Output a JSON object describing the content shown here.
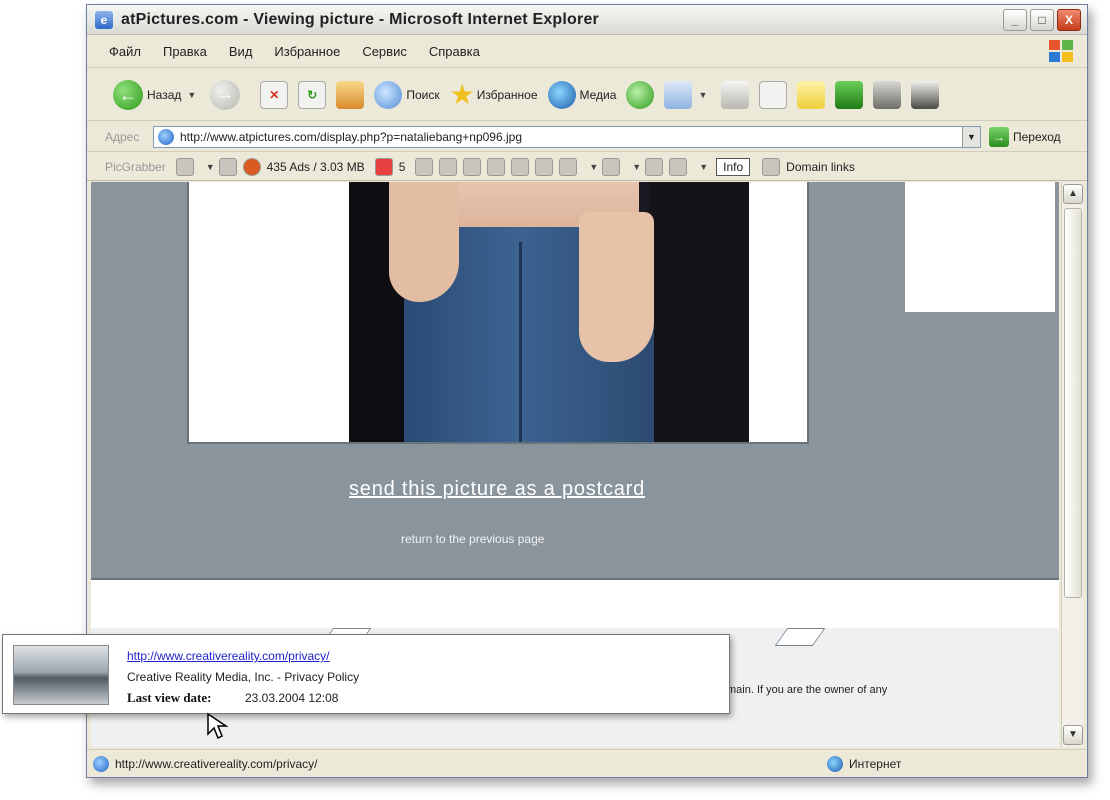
{
  "window": {
    "title": "atPictures.com - Viewing picture - Microsoft Internet Explorer",
    "title_icon": "ie-icon",
    "controls": {
      "minimize": "_",
      "maximize": "□",
      "close": "X"
    }
  },
  "menu": [
    "Файл",
    "Правка",
    "Вид",
    "Избранное",
    "Сервис",
    "Справка"
  ],
  "toolbar": {
    "back_label": "Назад",
    "search_label": "Поиск",
    "favorites_label": "Избранное",
    "media_label": "Медиа"
  },
  "address": {
    "label": "Адрес",
    "url": "http://www.atpictures.com/display.php?p=nataliebang+np096.jpg",
    "go_label": "Переход"
  },
  "grabber": {
    "label": "PicGrabber",
    "ads_count": "435 Ads / 3.03 MB",
    "popups_count": "5",
    "info_label": "Info",
    "domain_links_label": "Domain links"
  },
  "page": {
    "postcard_link": "send this picture as a postcard",
    "return_link": "return to the previous page",
    "copyright_fragment": "main. If you are the owner of any"
  },
  "tooltip": {
    "url": "http://www.creativereality.com/privacy/",
    "description": "Creative Reality Media, Inc. - Privacy Policy",
    "last_view_label": "Last view date:",
    "last_view_value": "23.03.2004 12:08"
  },
  "status": {
    "url": "http://www.creativereality.com/privacy/",
    "zone": "Интернет"
  },
  "colors": {
    "page_bg": "#8a949c",
    "window_chrome": "#ece9d8",
    "link": "#2222cc"
  }
}
